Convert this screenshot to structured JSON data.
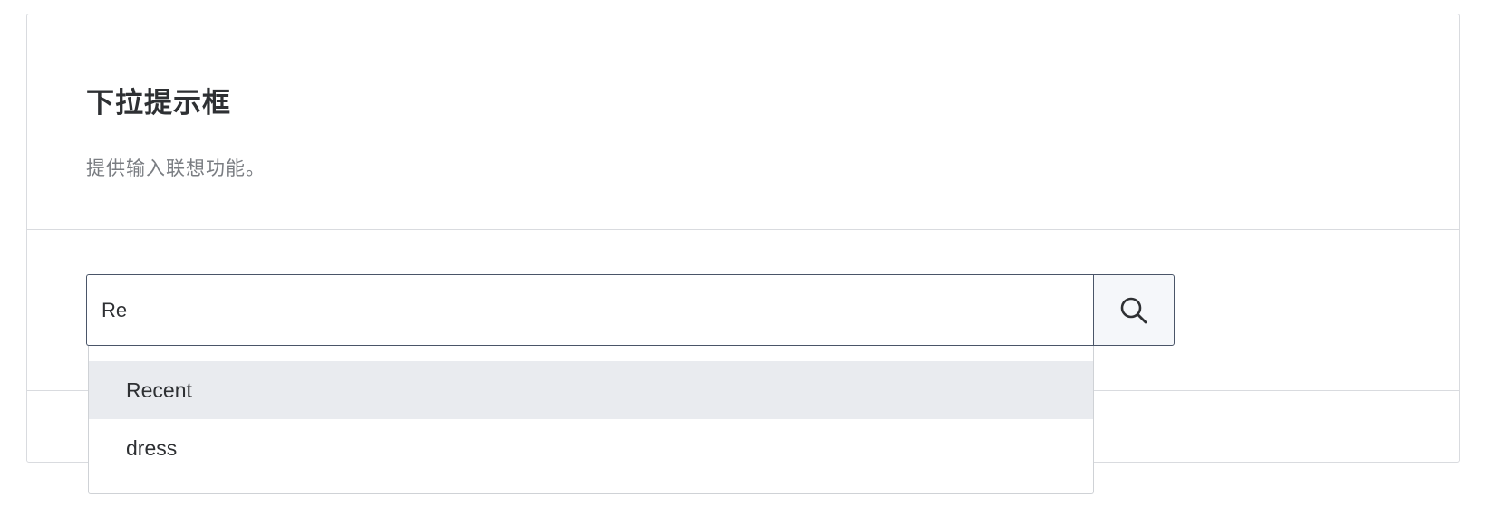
{
  "card": {
    "title": "下拉提示框",
    "description": "提供输入联想功能。"
  },
  "search": {
    "value": "Re",
    "button_icon": "search-icon"
  },
  "suggestions": {
    "active_index": 0,
    "items": [
      {
        "label": "Recent"
      },
      {
        "label": "dress"
      }
    ]
  },
  "colors": {
    "border": "#4a5568",
    "highlight": "#e9ebef",
    "divider": "#d9dbdf"
  }
}
